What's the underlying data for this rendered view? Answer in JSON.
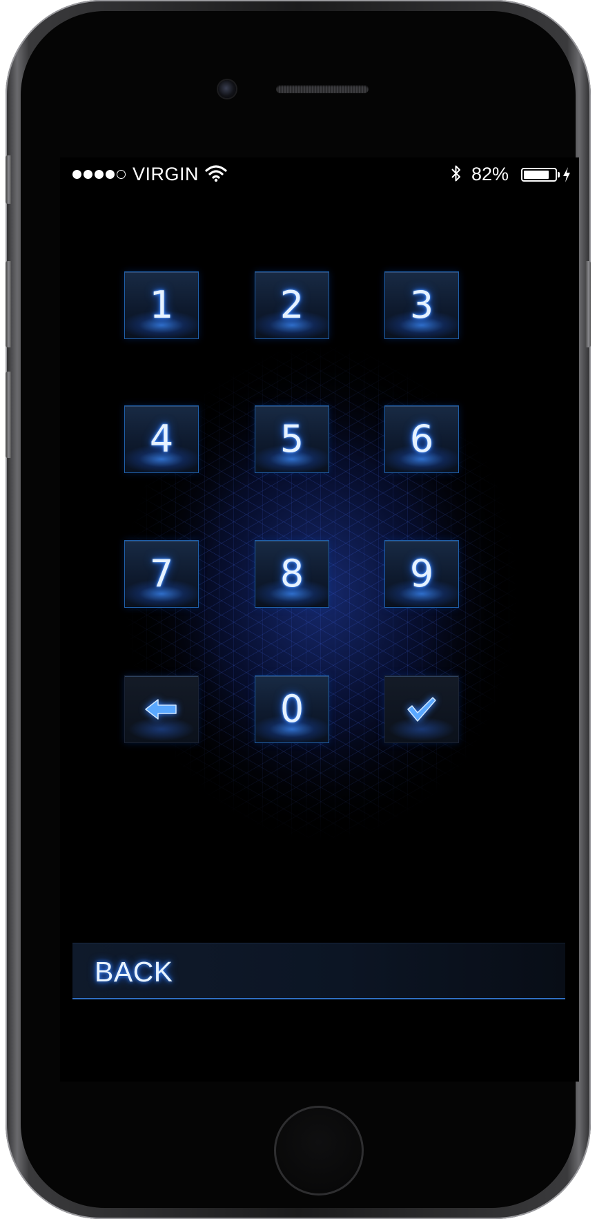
{
  "status_bar": {
    "signal_bars_filled": 4,
    "signal_bars_total": 5,
    "carrier": "VIRGIN",
    "wifi_icon": "wifi-icon",
    "bluetooth_icon": "bluetooth-icon",
    "battery_percent_text": "82%",
    "battery_level": 0.82,
    "charging_icon": "lightning-bolt-icon"
  },
  "keypad": {
    "keys": [
      "1",
      "2",
      "3",
      "4",
      "5",
      "6",
      "7",
      "8",
      "9"
    ],
    "backspace_icon": "arrow-left-icon",
    "zero": "0",
    "confirm_icon": "checkmark-icon"
  },
  "back_bar": {
    "label": "BACK"
  },
  "colors": {
    "accent_glow": "#3d8bff",
    "key_border": "#1f5fa8",
    "background": "#000000"
  }
}
